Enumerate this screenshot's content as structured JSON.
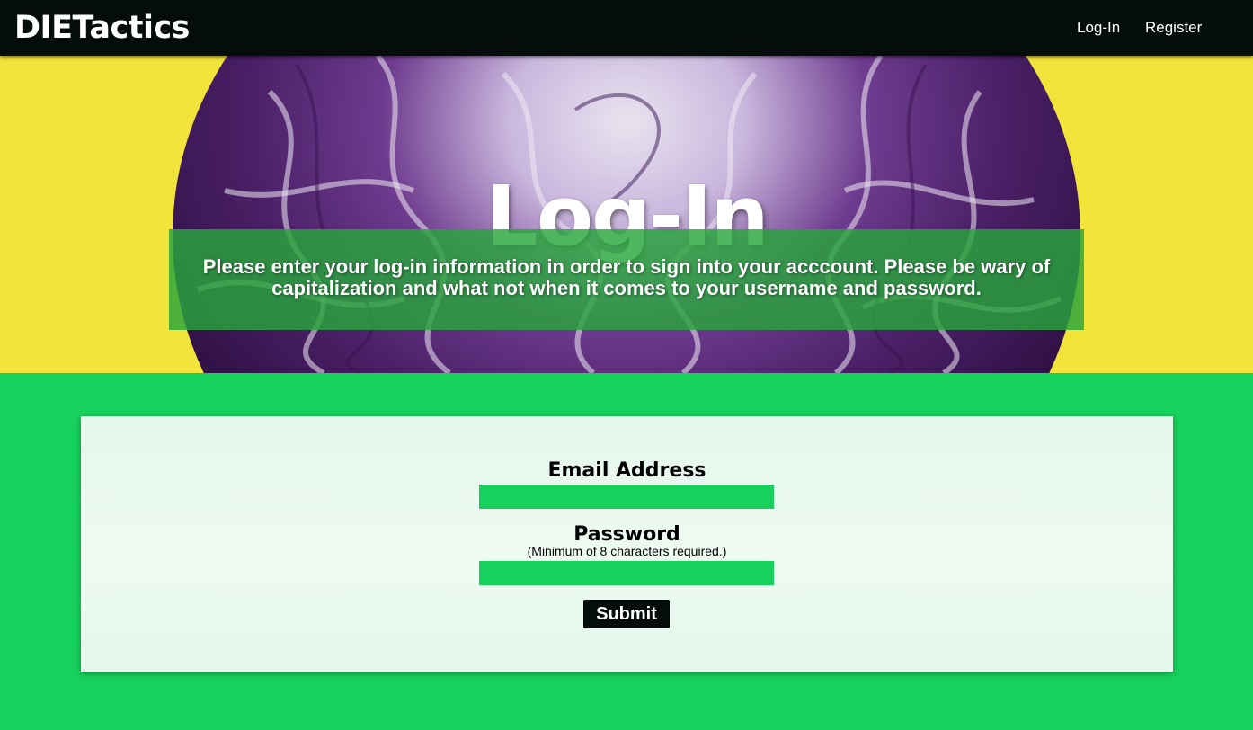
{
  "navbar": {
    "brand": "DIETactics",
    "links": [
      {
        "label": "Log-In"
      },
      {
        "label": "Register"
      }
    ]
  },
  "hero": {
    "title": "Log-In",
    "message": "Please enter your log-in information in order to sign into your acccount. Please be wary of capitalization and what not when it comes to your username and password."
  },
  "form": {
    "email_label": "Email Address",
    "email_value": "",
    "password_label": "Password",
    "password_hint": "(Minimum of 8 characters required.)",
    "password_value": "",
    "submit_label": "Submit"
  },
  "colors": {
    "navbar": "#040d09",
    "accent_green": "#16d15c",
    "hero_yellow": "#f2e43a",
    "message_overlay": "#28a53c",
    "card": "#eaf9f0"
  }
}
